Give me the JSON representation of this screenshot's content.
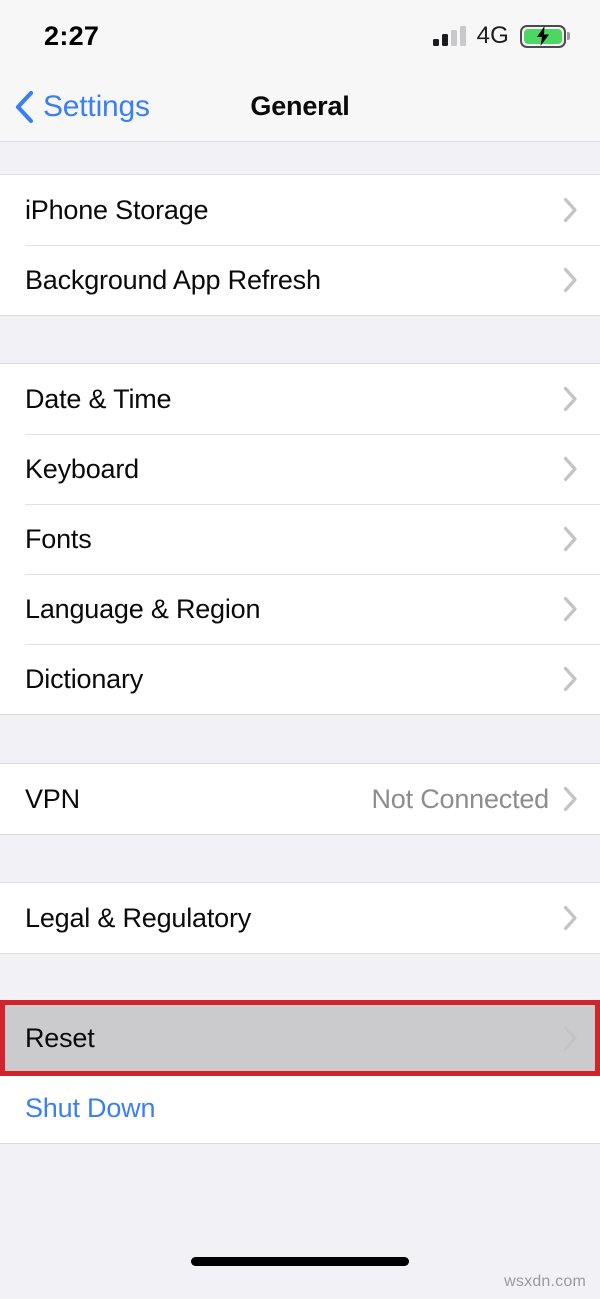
{
  "status_bar": {
    "time": "2:27",
    "network_label": "4G",
    "signal_bars_active": 2,
    "signal_bars_total": 4,
    "battery_charging": true,
    "battery_color": "#4cd662"
  },
  "nav": {
    "back_label": "Settings",
    "title": "General"
  },
  "theme": {
    "accent_blue": "#3b7ff5",
    "group_background": "#f1f1f6",
    "row_background": "#ffffff",
    "separator": "#e2e2e6",
    "value_gray": "#8c8c91",
    "chevron_gray": "#c4c4c6",
    "annotation_red": "#d0232b",
    "pressed_gray": "#cbcbce"
  },
  "groups": [
    {
      "rows": [
        {
          "label": "iPhone Storage",
          "value": "",
          "chevron": true,
          "style": "default"
        },
        {
          "label": "Background App Refresh",
          "value": "",
          "chevron": true,
          "style": "default"
        }
      ]
    },
    {
      "rows": [
        {
          "label": "Date & Time",
          "value": "",
          "chevron": true,
          "style": "default"
        },
        {
          "label": "Keyboard",
          "value": "",
          "chevron": true,
          "style": "default"
        },
        {
          "label": "Fonts",
          "value": "",
          "chevron": true,
          "style": "default"
        },
        {
          "label": "Language & Region",
          "value": "",
          "chevron": true,
          "style": "default"
        },
        {
          "label": "Dictionary",
          "value": "",
          "chevron": true,
          "style": "default"
        }
      ]
    },
    {
      "rows": [
        {
          "label": "VPN",
          "value": "Not Connected",
          "chevron": true,
          "style": "default"
        }
      ]
    },
    {
      "rows": [
        {
          "label": "Legal & Regulatory",
          "value": "",
          "chevron": true,
          "style": "default"
        }
      ]
    },
    {
      "rows": [
        {
          "label": "Reset",
          "value": "",
          "chevron": true,
          "style": "pressed"
        },
        {
          "label": "Shut Down",
          "value": "",
          "chevron": false,
          "style": "blue"
        }
      ]
    }
  ],
  "annotation": {
    "target_row_label": "Reset",
    "color": "#d0232b"
  },
  "watermark": "wsxdn.com"
}
